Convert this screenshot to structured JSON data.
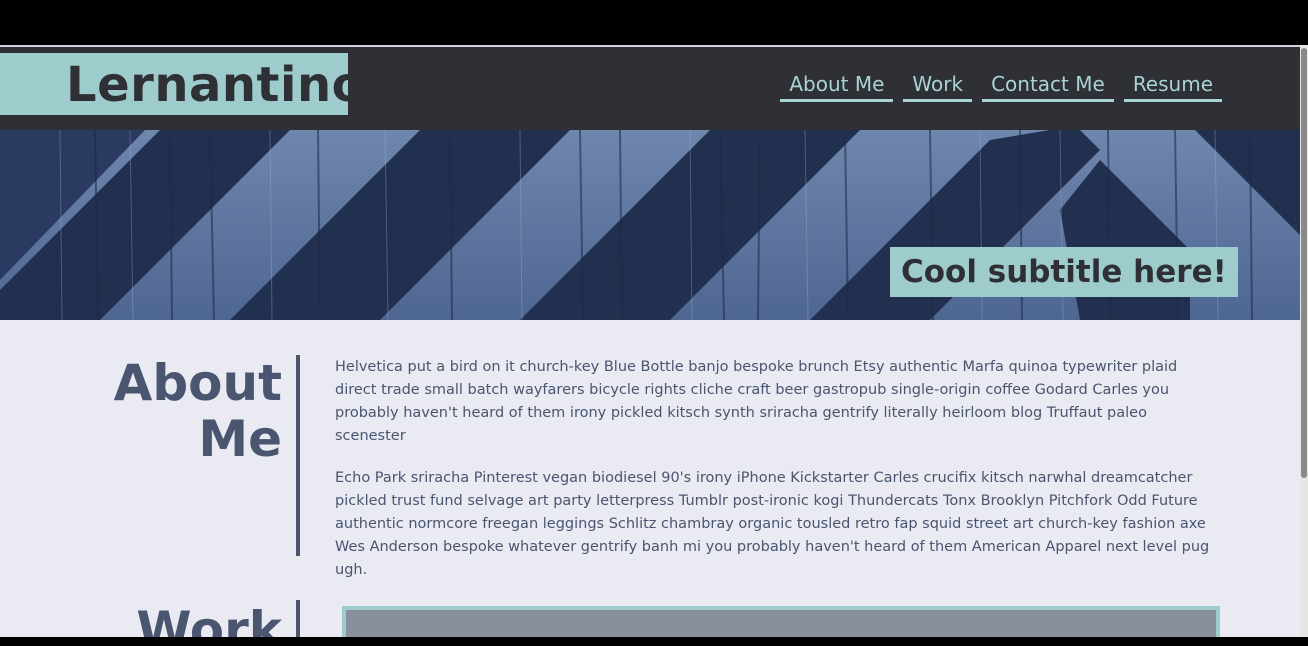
{
  "site": {
    "logo": "Lernantino",
    "nav": [
      "About Me",
      "Work",
      "Contact Me",
      "Resume"
    ],
    "subtitle": "Cool subtitle here!"
  },
  "about": {
    "title_line1": "About",
    "title_line2": "Me",
    "paragraphs": [
      "Helvetica put a bird on it church-key Blue Bottle banjo bespoke brunch Etsy authentic Marfa quinoa typewriter plaid direct trade small batch wayfarers bicycle rights cliche craft beer gastropub single-origin coffee Godard Carles you probably haven't heard of them irony pickled kitsch synth sriracha gentrify literally heirloom blog Truffaut paleo scenester",
      "Echo Park sriracha Pinterest vegan biodiesel 90's irony iPhone Kickstarter Carles crucifix kitsch narwhal dreamcatcher pickled trust fund selvage art party letterpress Tumblr post-ironic kogi Thundercats Tonx Brooklyn Pitchfork Odd Future authentic normcore freegan leggings Schlitz chambray organic tousled retro fap squid street art church-key fashion axe Wes Anderson bespoke whatever gentrify banh mi you probably haven't heard of them American Apparel next level pug ugh."
    ]
  },
  "work": {
    "title": "Work"
  },
  "colors": {
    "header_bg": "#2e3036",
    "accent": "#9ecbcb",
    "page_bg": "#e9eaf2",
    "text": "#4a5570"
  }
}
